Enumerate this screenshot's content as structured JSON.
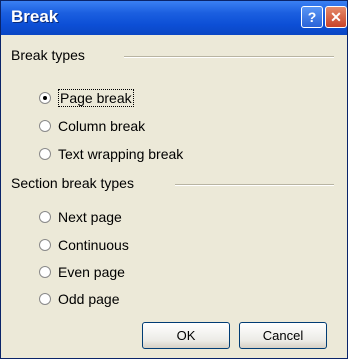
{
  "window": {
    "title": "Break",
    "help_label": "?",
    "close_label": "✕"
  },
  "break_types": {
    "label": "Break types",
    "options": [
      {
        "label": "Page break",
        "selected": true
      },
      {
        "label": "Column break",
        "selected": false
      },
      {
        "label": "Text wrapping break",
        "selected": false
      }
    ]
  },
  "section_break_types": {
    "label": "Section break types",
    "options": [
      {
        "label": "Next page",
        "selected": false
      },
      {
        "label": "Continuous",
        "selected": false
      },
      {
        "label": "Even page",
        "selected": false
      },
      {
        "label": "Odd page",
        "selected": false
      }
    ]
  },
  "buttons": {
    "ok": "OK",
    "cancel": "Cancel"
  }
}
